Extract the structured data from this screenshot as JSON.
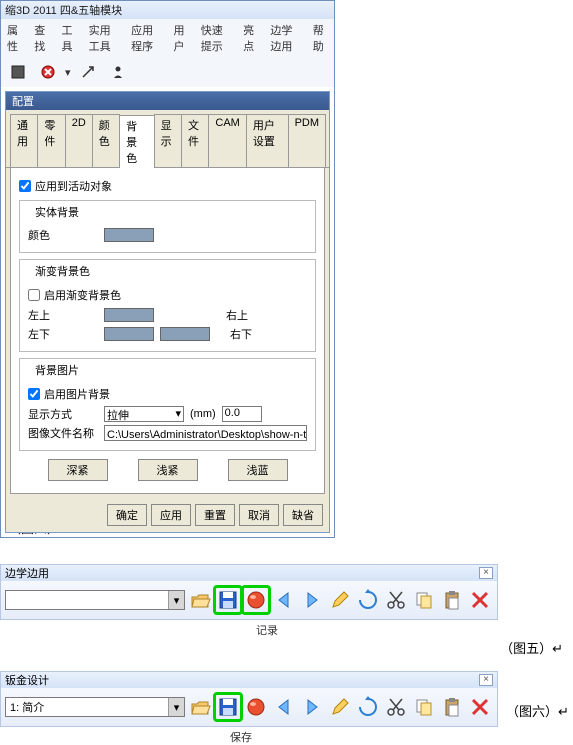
{
  "win1": {
    "title": "缩3D 2011 四&五轴模块",
    "menus": [
      "属性",
      "查找",
      "工具",
      "实用工具",
      "应用程序",
      "用户",
      "快速提示",
      "亮点",
      "边学边用",
      "帮助"
    ]
  },
  "dlg": {
    "title": "配置",
    "tabs": [
      "通用",
      "零件",
      "2D",
      "颜色",
      "背景色",
      "显示",
      "文件",
      "CAM",
      "用户设置",
      "PDM"
    ],
    "active_tab_index": 4,
    "apply_to_active": "应用到活动对象",
    "solid_group": "实体背景",
    "color_label": "颜色",
    "grad_group": "渐变背景色",
    "enable_grad": "启用渐变背景色",
    "tl": "左上",
    "tr": "右上",
    "bl": "左下",
    "br": "右下",
    "img_group": "背景图片",
    "enable_img": "启用图片背景",
    "display_mode": "显示方式",
    "display_value": "拉伸",
    "unit": "(mm)",
    "unit_value": "0.0",
    "img_name_label": "图像文件名称",
    "img_name_value": "C:\\Users\\Administrator\\Desktop\\show-n-tell制作\\钣金",
    "btn_deep": "深紧",
    "btn_shallow": "浅紧",
    "btn_blue": "浅蓝",
    "ok": "确定",
    "apply": "应用",
    "reset": "重置",
    "cancel": "取消",
    "default": "缺省"
  },
  "captions": {
    "four": "（图四）↵",
    "five": "（图五）↵",
    "six": "（图六）↵"
  },
  "tb2": {
    "title": "边学边用",
    "sub": "记录"
  },
  "tb3": {
    "title": "钣金设计",
    "combo": "1: 简介",
    "sub": "保存"
  }
}
